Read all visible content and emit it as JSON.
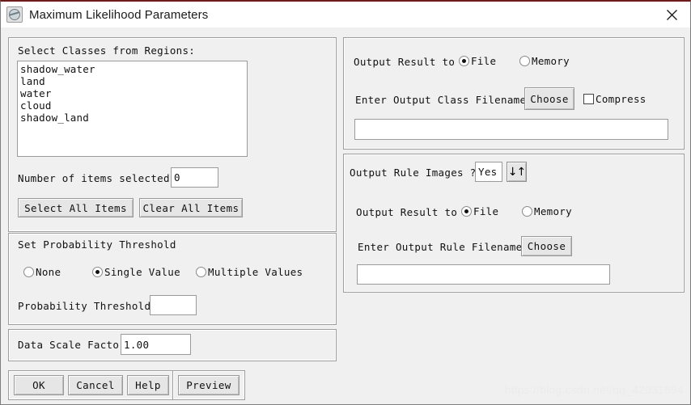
{
  "window": {
    "title": "Maximum Likelihood Parameters",
    "icon": "app-globe-icon",
    "close_label": "✕",
    "accent_top_color": "#6e1b1b",
    "background_color": "#f0f0f0"
  },
  "classes_panel": {
    "heading": "Select Classes from Regions:",
    "items": [
      "shadow_water",
      "land",
      "water",
      "cloud",
      "shadow_land"
    ],
    "count_label": "Number of items selected:",
    "count_value": "0",
    "select_all_label": "Select All Items",
    "clear_all_label": "Clear All Items"
  },
  "threshold_panel": {
    "heading": "Set Probability Threshold",
    "options": [
      {
        "label": "None",
        "selected": false
      },
      {
        "label": "Single Value",
        "selected": true
      },
      {
        "label": "Multiple Values",
        "selected": false
      }
    ],
    "threshold_label": "Probability Threshold",
    "threshold_value": ""
  },
  "scale_panel": {
    "label": "Data Scale Factor",
    "value": "1.00"
  },
  "class_output_panel": {
    "output_label": "Output Result to",
    "options": [
      {
        "label": "File",
        "selected": true
      },
      {
        "label": "Memory",
        "selected": false
      }
    ],
    "filename_label": "Enter Output Class Filename",
    "choose_label": "Choose",
    "compress_label": "Compress",
    "compress_checked": false,
    "filename_value": ""
  },
  "rule_output_panel": {
    "rule_label": "Output Rule Images ?",
    "rule_value": "Yes",
    "toggle_glyph": "↓↑",
    "output_label": "Output Result to",
    "options": [
      {
        "label": "File",
        "selected": true
      },
      {
        "label": "Memory",
        "selected": false
      }
    ],
    "filename_label": "Enter Output Rule Filename",
    "choose_label": "Choose",
    "filename_value": ""
  },
  "actions": {
    "ok_label": "OK",
    "cancel_label": "Cancel",
    "help_label": "Help",
    "preview_label": "Preview"
  },
  "watermark": "https://blog.csdn.net/qq_42031694"
}
